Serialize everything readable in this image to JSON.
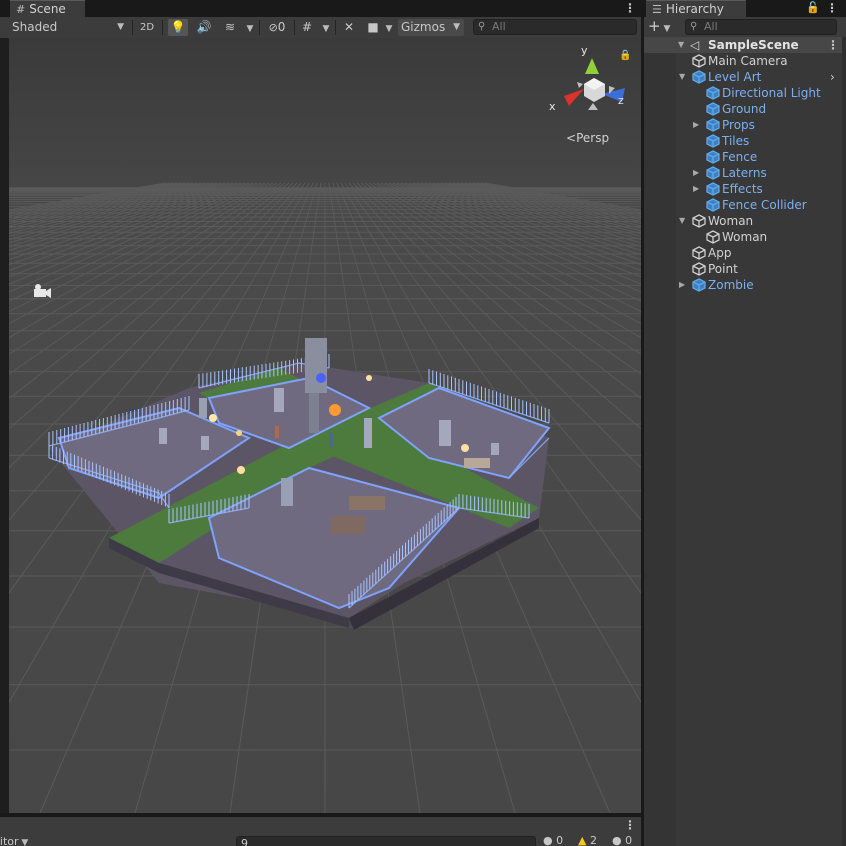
{
  "scene_tab": {
    "icon": "grid-icon",
    "label": "Scene"
  },
  "scene_toolbar": {
    "draw_mode": "Shaded",
    "toggle_2d": "2D",
    "hidden_count": "0",
    "gizmos_label": "Gizmos",
    "search_placeholder": "All"
  },
  "viewport": {
    "axes": {
      "x": "x",
      "y": "y",
      "z": "z"
    },
    "projection_label": "Persp",
    "colors": {
      "x_axis": "#d9332b",
      "y_axis": "#8ed13a",
      "z_axis": "#3b6ed9",
      "grid_bg": "#464646"
    }
  },
  "console": {
    "editor_dropdown": "Editor",
    "search_value": "9",
    "log_count": "0",
    "warning_count": "2",
    "error_count": "0"
  },
  "hierarchy": {
    "tab_label": "Hierarchy",
    "search_placeholder": "All",
    "scene_name": "SampleScene",
    "items": [
      {
        "label": "Main Camera",
        "depth": 1,
        "prefab": false,
        "arrow": ""
      },
      {
        "label": "Level Art",
        "depth": 1,
        "prefab": true,
        "arrow": "expanded"
      },
      {
        "label": "Directional Light",
        "depth": 2,
        "prefab": true,
        "arrow": ""
      },
      {
        "label": "Ground",
        "depth": 2,
        "prefab": true,
        "arrow": ""
      },
      {
        "label": "Props",
        "depth": 2,
        "prefab": true,
        "arrow": "collapsed"
      },
      {
        "label": "Tiles",
        "depth": 2,
        "prefab": true,
        "arrow": ""
      },
      {
        "label": "Fence",
        "depth": 2,
        "prefab": true,
        "arrow": ""
      },
      {
        "label": "Laterns",
        "depth": 2,
        "prefab": true,
        "arrow": "collapsed"
      },
      {
        "label": "Effects",
        "depth": 2,
        "prefab": true,
        "arrow": "collapsed"
      },
      {
        "label": "Fence Collider",
        "depth": 2,
        "prefab": true,
        "arrow": ""
      },
      {
        "label": "Woman",
        "depth": 1,
        "prefab": false,
        "arrow": "expanded"
      },
      {
        "label": "Woman",
        "depth": 2,
        "prefab": false,
        "arrow": ""
      },
      {
        "label": "App",
        "depth": 1,
        "prefab": false,
        "arrow": ""
      },
      {
        "label": "Point",
        "depth": 1,
        "prefab": false,
        "arrow": ""
      },
      {
        "label": "Zombie",
        "depth": 1,
        "prefab": true,
        "arrow": "collapsed"
      }
    ]
  }
}
